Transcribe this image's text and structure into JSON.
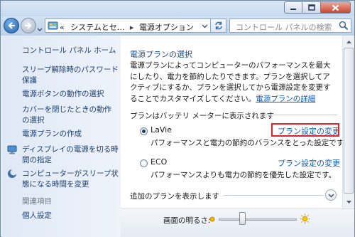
{
  "address": {
    "chevron": "«",
    "crumbs": [
      "システムとセ...",
      "電源オプション"
    ],
    "separator": "▸",
    "dropdown_icon": "chevron-down-icon",
    "refresh_icon": "refresh-icon"
  },
  "search": {
    "placeholder": "コントロール パネルの検索"
  },
  "sidebar": {
    "home": "コントロール パネル ホーム",
    "items": [
      {
        "label": "スリープ解除時のパスワード保護",
        "icon": null
      },
      {
        "label": "電源ボタンの動作の選択",
        "icon": null
      },
      {
        "label": "カバーを閉じたときの動作の選択",
        "icon": null
      },
      {
        "label": "電源プランの作成",
        "icon": null
      },
      {
        "label": "ディスプレイの電源を切る時間の指定",
        "icon": "display-icon"
      },
      {
        "label": "コンピューターがスリープ状態になる時間を変更",
        "icon": "moon-icon"
      }
    ],
    "related_heading": "関連項目",
    "related": [
      {
        "label": "個人設定"
      }
    ]
  },
  "main": {
    "title": "電源プランの選択",
    "description": "電源プランによってコンピューターのパフォーマンスを最大にしたり、電力を節約したりできます。プランを選択してアクティブにするか、プランを選択してから電源設定を変更することでカスタマイズしてください。",
    "description_link": "電源プランの詳細",
    "section_label": "プランはバッテリ メーターに表示されます",
    "plans": [
      {
        "name": "LaVie",
        "selected": true,
        "link": "プラン設定の変更",
        "description": "パフォーマンスと電力の節約のバランスをとった設定です。"
      },
      {
        "name": "ECO",
        "selected": false,
        "link": "プラン設定の変更",
        "description": "パフォーマンスよりも電力の節約を優先した設定です。"
      }
    ],
    "more_plans": "追加のプランを表示します"
  },
  "bottom": {
    "brightness_label": "画面の明るさ:",
    "brightness_level": 0.3
  },
  "colors": {
    "link": "#0b5cb8",
    "highlight": "#e0202a",
    "sidebar_text": "#1e3f6e"
  }
}
